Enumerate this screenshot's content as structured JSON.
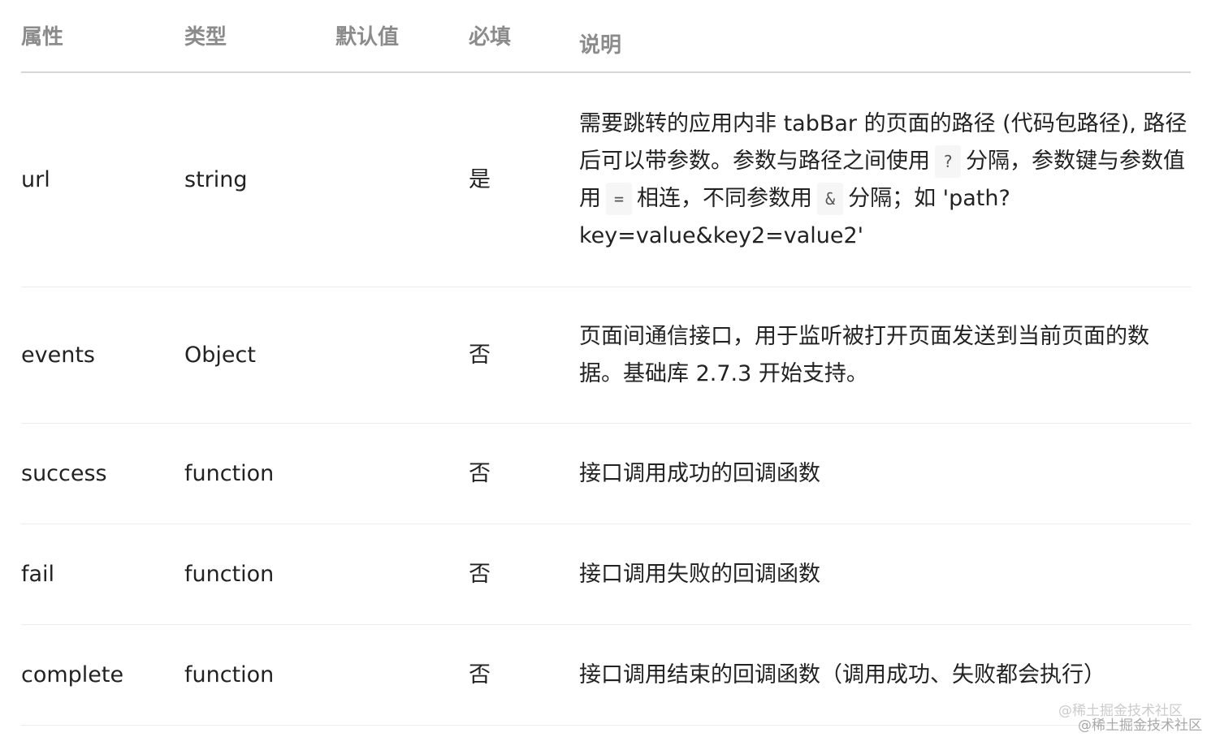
{
  "table": {
    "headers": {
      "name": "属性",
      "type": "类型",
      "default": "默认值",
      "required": "必填",
      "description": "说明"
    },
    "rows": [
      {
        "name": "url",
        "type": "string",
        "default": "",
        "required": "是",
        "description_parts": [
          "需要跳转的应用内非 tabBar 的页面的路径 (代码包路径), 路径后可以带参数。参数与路径之间使用",
          "?",
          "分隔，参数键与参数值用",
          "=",
          "相连，不同参数用",
          "&",
          "分隔；如 'path?key=value&key2=value2'"
        ]
      },
      {
        "name": "events",
        "type": "Object",
        "default": "",
        "required": "否",
        "description": "页面间通信接口，用于监听被打开页面发送到当前页面的数据。基础库 2.7.3 开始支持。"
      },
      {
        "name": "success",
        "type": "function",
        "default": "",
        "required": "否",
        "description": "接口调用成功的回调函数"
      },
      {
        "name": "fail",
        "type": "function",
        "default": "",
        "required": "否",
        "description": "接口调用失败的回调函数"
      },
      {
        "name": "complete",
        "type": "function",
        "default": "",
        "required": "否",
        "description": "接口调用结束的回调函数（调用成功、失败都会执行）"
      }
    ]
  },
  "watermark": {
    "line1": "@稀土掘金技术社区",
    "line2": "@稀土掘金技术社区"
  }
}
